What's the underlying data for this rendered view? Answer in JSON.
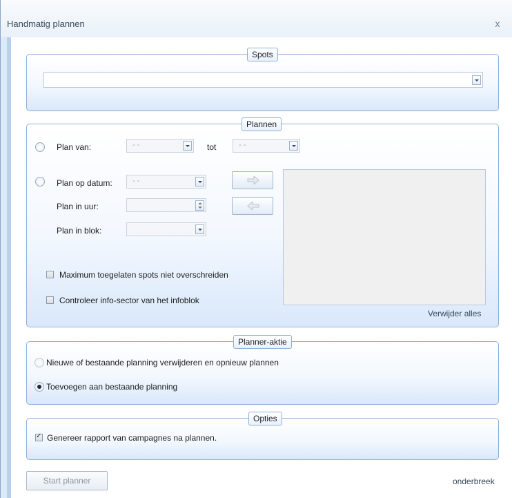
{
  "window": {
    "title": "Handmatig plannen",
    "close_glyph": "x"
  },
  "spots": {
    "legend": "Spots",
    "value": ""
  },
  "plannen": {
    "legend": "Plannen",
    "plan_van_label": "Plan van:",
    "plan_van_value": "- -",
    "tot_label": "tot",
    "tot_value": "- -",
    "plan_op_datum_label": "Plan op datum:",
    "plan_op_datum_value": "- -",
    "plan_in_uur_label": "Plan in uur:",
    "plan_in_blok_label": "Plan in blok:",
    "max_spots_label": "Maximum toegelaten spots niet overschreiden",
    "controleer_label": "Controleer info-sector van het infoblok",
    "verwijder_alles": "Verwijder alles",
    "add_icon": "arrow-right-icon",
    "remove_icon": "arrow-left-icon"
  },
  "planner_actie": {
    "legend": "Planner-aktie",
    "option_replace": "Nieuwe of bestaande planning verwijderen en opnieuw plannen",
    "option_add": "Toevoegen aan bestaande planning",
    "selected": "option_add"
  },
  "opties": {
    "legend": "Opties",
    "genereer_label": "Genereer rapport van campagnes na plannen.",
    "genereer_checked": true
  },
  "footer": {
    "start_button": "Start planner",
    "cancel_link": "onderbreek"
  },
  "colors": {
    "window_bg": "#dce9f8",
    "group_border": "#8fb0d6",
    "accent_strip": "#b8d1ef"
  }
}
